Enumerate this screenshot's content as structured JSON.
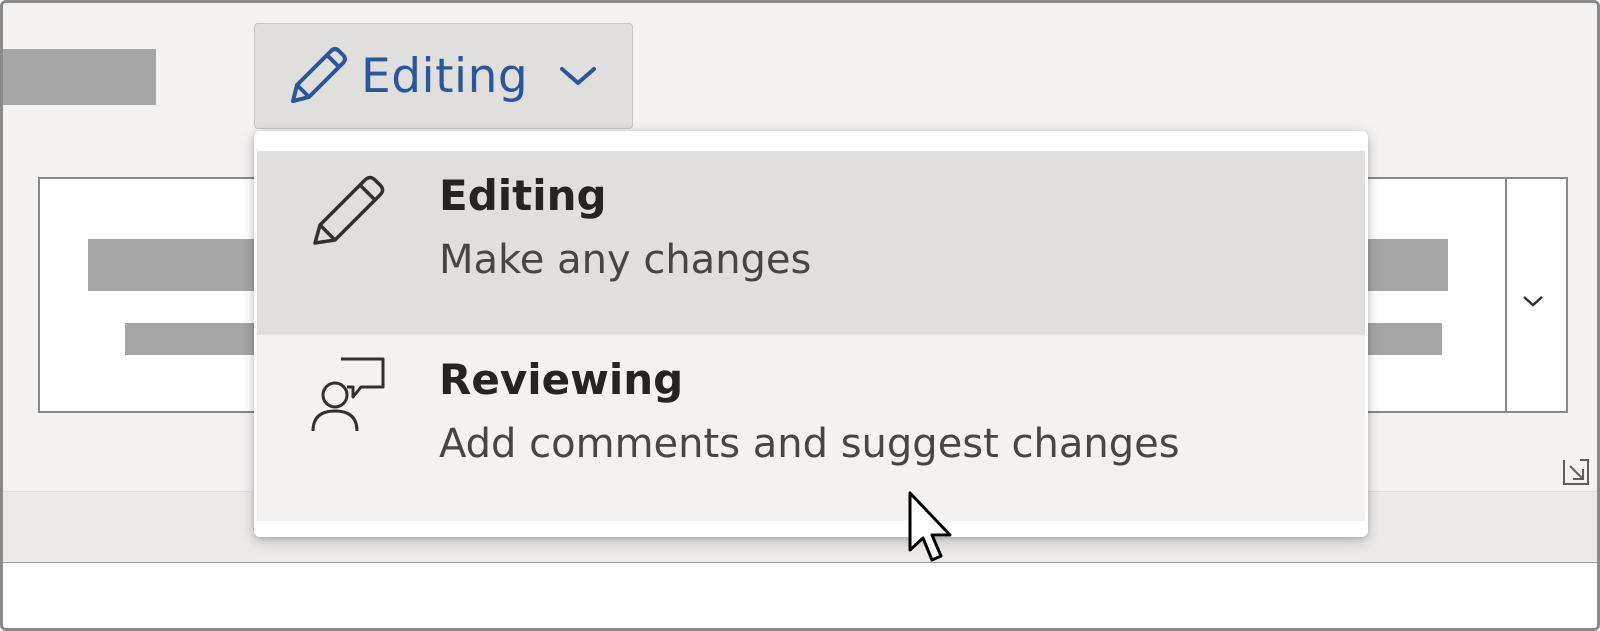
{
  "mode_button": {
    "label": "Editing",
    "icon": "pencil-icon",
    "chevron_icon": "chevron-down-icon"
  },
  "mode_menu": {
    "items": [
      {
        "icon": "pencil-icon",
        "title": "Editing",
        "description": "Make any changes",
        "selected": true
      },
      {
        "icon": "person-comment-icon",
        "title": "Reviewing",
        "description": "Add comments and suggest changes",
        "selected": false
      }
    ]
  },
  "styles_gallery": {
    "more_icon": "chevron-down-icon",
    "launcher_icon": "dialog-launcher-icon"
  },
  "colors": {
    "accent": "#2b579a",
    "ribbon_bg": "#f3f2f1",
    "selected_item_bg": "#e1dfdd",
    "placeholder": "#a6a6a6"
  }
}
